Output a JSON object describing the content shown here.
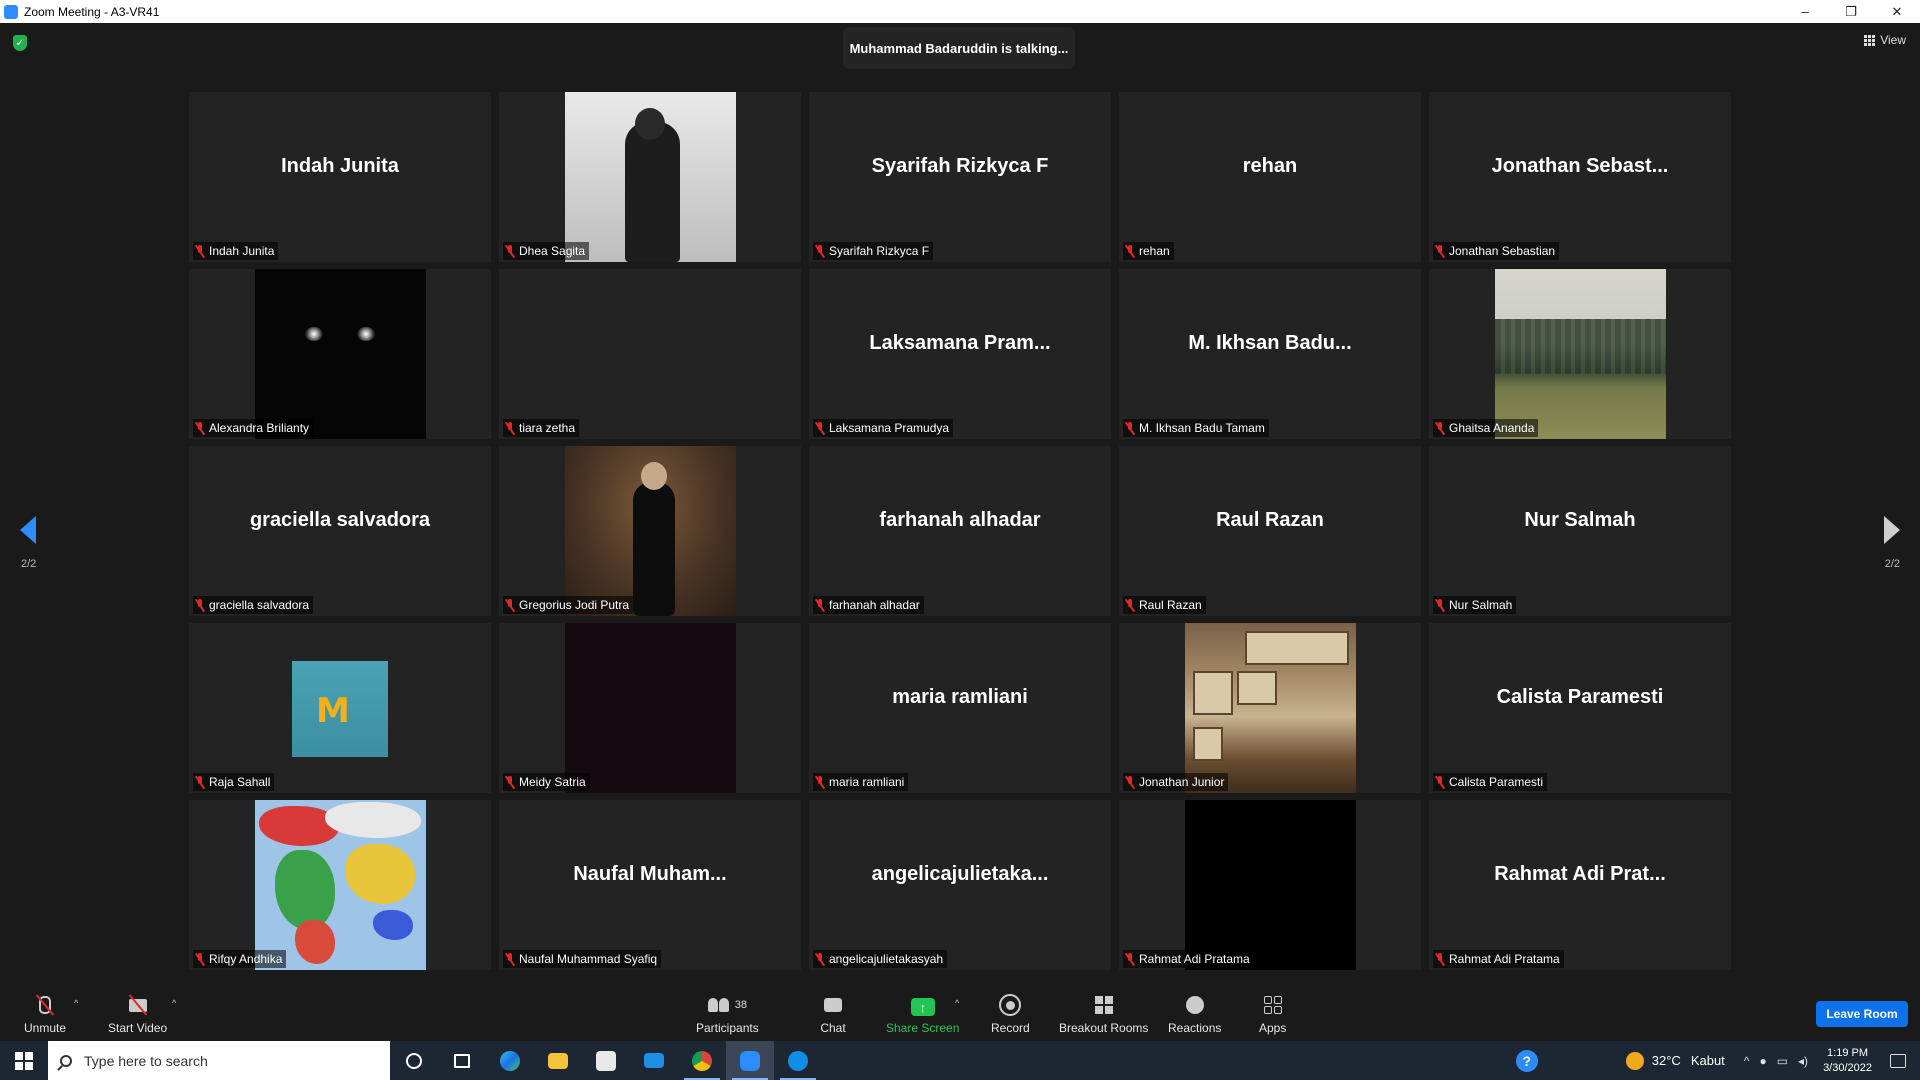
{
  "window": {
    "title": "Zoom Meeting - A3-VR41",
    "minimize": "–",
    "restore": "❐",
    "close": "✕"
  },
  "meeting": {
    "talking": "Muhammad Badaruddin is talking...",
    "view_label": "View",
    "page_left": "2/2",
    "page_right": "2/2"
  },
  "tiles": [
    {
      "big": "Indah Junita",
      "label": "Indah Junita"
    },
    {
      "big": "",
      "label": "Dhea Sagita"
    },
    {
      "big": "Syarifah Rizkyca F",
      "label": "Syarifah Rizkyca F"
    },
    {
      "big": "rehan",
      "label": "rehan"
    },
    {
      "big": "Jonathan Sebast...",
      "label": "Jonathan Sebastian"
    },
    {
      "big": "",
      "label": "Alexandra Brilianty"
    },
    {
      "big": "",
      "label": "tiara zetha"
    },
    {
      "big": "Laksamana Pram...",
      "label": "Laksamana Pramudya"
    },
    {
      "big": "M. Ikhsan Badu...",
      "label": "M. Ikhsan Badu Tamam"
    },
    {
      "big": "",
      "label": "Ghaitsa Ananda"
    },
    {
      "big": "graciella salvadora",
      "label": "graciella salvadora"
    },
    {
      "big": "",
      "label": "Gregorius Jodi Putra"
    },
    {
      "big": "farhanah alhadar",
      "label": "farhanah alhadar"
    },
    {
      "big": "Raul Razan",
      "label": "Raul Razan"
    },
    {
      "big": "Nur Salmah",
      "label": "Nur Salmah"
    },
    {
      "big": "",
      "label": "Raja Sahall"
    },
    {
      "big": "",
      "label": "Meidy Satria"
    },
    {
      "big": "maria ramliani",
      "label": "maria ramliani"
    },
    {
      "big": "",
      "label": "Jonathan Junior"
    },
    {
      "big": "Calista Paramesti",
      "label": "Calista Paramesti"
    },
    {
      "big": "",
      "label": "Rifqy Andhika"
    },
    {
      "big": "Naufal Muham...",
      "label": "Naufal Muhammad Syafiq"
    },
    {
      "big": "angelicajulietaka...",
      "label": "angelicajulietakasyah"
    },
    {
      "big": "",
      "label": "Rahmat Adi Pratama"
    },
    {
      "big": "Rahmat Adi Prat...",
      "label": "Rahmat Adi Pratama"
    }
  ],
  "toolbar": {
    "unmute": "Unmute",
    "start_video": "Start Video",
    "participants": "Participants",
    "participants_count": "38",
    "chat": "Chat",
    "share_screen": "Share Screen",
    "share_color": "#23c552",
    "record": "Record",
    "breakout": "Breakout Rooms",
    "reactions": "Reactions",
    "apps": "Apps",
    "leave": "Leave Room",
    "leave_color": "#0e72ed"
  },
  "taskbar": {
    "search_placeholder": "Type here to search",
    "temperature": "32°C",
    "weather": "Kabut",
    "time": "1:19 PM",
    "date": "3/30/2022"
  }
}
